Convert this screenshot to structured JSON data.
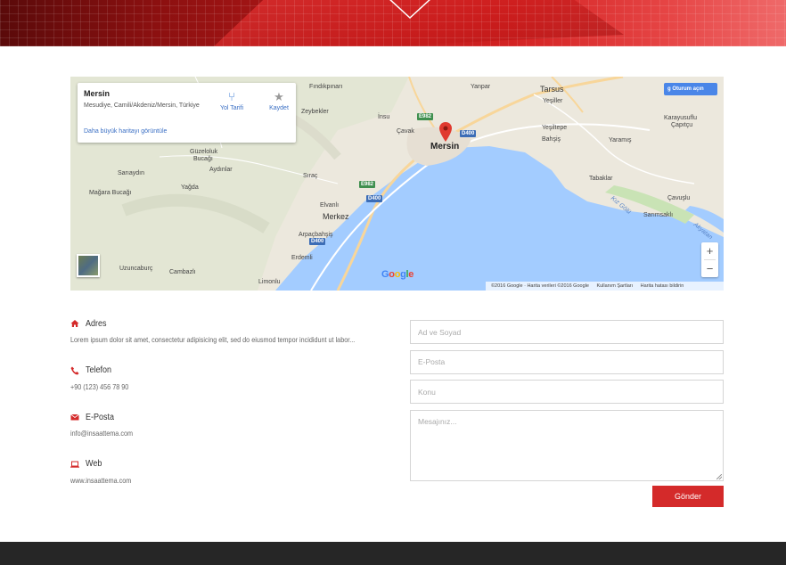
{
  "map": {
    "place_card": {
      "name": "Mersin",
      "address": "Mesudiye, Camili/Akdeniz/Mersin, Türkiye",
      "larger_map_link": "Daha büyük haritayı görüntüle",
      "directions_label": "Yol Tarifi",
      "save_label": "Kaydet"
    },
    "sign_in_label": "Oturum açın",
    "zoom_in": "+",
    "zoom_out": "−",
    "google_logo": "Google",
    "attribution": {
      "copyright": "©2016 Google · Harita verileri ©2016 Google",
      "terms": "Kullanım Şartları",
      "report": "Harita hatası bildirin"
    },
    "labels": {
      "findikpinari": "Fındıkpınarı",
      "yanpar": "Yanpar",
      "tarsus": "Tarsus",
      "zeybekler": "Zeybekler",
      "insu": "İnsu",
      "yesiller": "Yeşiller",
      "karayusuflu": "Karayusuflu",
      "capiticu": "Çapıtçu",
      "yesiltepe": "Yeşiltepe",
      "bahsis": "Bahşiş",
      "yaramis": "Yaramış",
      "cavak": "Çavak",
      "mersin": "Mersin",
      "guzeloluk": "Güzeloluk",
      "bucagi": "Bucağı",
      "aydinlar": "Aydınlar",
      "sariaydin": "Sarıaydın",
      "sirac": "Sıraç",
      "tabaklar": "Tabaklar",
      "yagda": "Yağda",
      "magara": "Mağara Bucağı",
      "elvanli": "Elvanlı",
      "kuzgolu": "Kız Gölü",
      "cavuslu": "Çavuşlu",
      "merkez": "Merkez",
      "sarimsakli": "Sarımsaklı",
      "arpacbahsis": "Arpaçbahşiş",
      "akyatan": "Akyatan",
      "erdemli": "Erdemli",
      "uzuncaburc": "Uzuncaburç",
      "cambazli": "Cambazlı",
      "limonlu": "Limonlu"
    },
    "shields": {
      "e982a": "E982",
      "d400a": "D400",
      "e982b": "E982",
      "d400b": "D400",
      "d400c": "D400"
    }
  },
  "contact": {
    "address": {
      "title": "Adres",
      "value": "Lorem ipsum dolor sit amet, consectetur adipisicing elit, sed do eiusmod tempor incididunt ut labor..."
    },
    "phone": {
      "title": "Telefon",
      "value": "+90 (123) 456 78 90"
    },
    "email": {
      "title": "E-Posta",
      "value": "info@insaattema.com"
    },
    "web": {
      "title": "Web",
      "value": "www.insaattema.com"
    }
  },
  "form": {
    "name_placeholder": "Ad ve Soyad",
    "email_placeholder": "E-Posta",
    "subject_placeholder": "Konu",
    "message_placeholder": "Mesajınız...",
    "submit_label": "Gönder"
  },
  "colors": {
    "accent": "#d42a2a",
    "footer": "#262626",
    "sea": "#a3ccff"
  }
}
